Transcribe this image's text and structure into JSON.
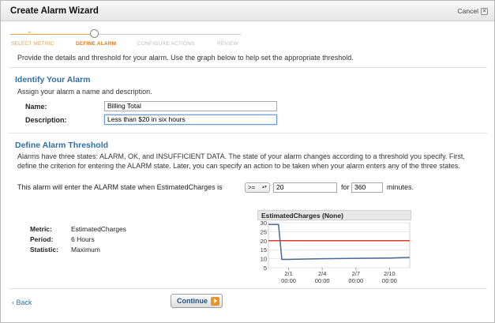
{
  "dialog": {
    "title": "Create Alarm Wizard",
    "cancel_label": "Cancel"
  },
  "wizard": {
    "steps": [
      {
        "label": "SELECT METRIC",
        "state": "done"
      },
      {
        "label": "DEFINE ALARM",
        "state": "active"
      },
      {
        "label": "CONFIGURE ACTIONS",
        "state": "pending"
      },
      {
        "label": "REVIEW",
        "state": "pending"
      }
    ]
  },
  "intro": "Provide the details and threshold for your alarm. Use the graph below to help set the appropriate threshold.",
  "identify": {
    "title": "Identify Your Alarm",
    "description": "Assign your alarm a name and description.",
    "name_label": "Name:",
    "name_value": "Billing Total",
    "description_label": "Description:",
    "description_value": "Less than $20 in six hours"
  },
  "threshold": {
    "title": "Define Alarm Threshold",
    "description": "Alarms have three states: ALARM, OK, and INSUFFICIENT DATA. The state of your alarm changes according to a threshold you specify. First, define the criterion for entering the ALARM state. Later, you can specify an action to be taken when your alarm enters any of the three states.",
    "sentence_prefix": "This alarm will enter the ALARM state when EstimatedCharges is",
    "operator": ">=",
    "threshold_value": "20",
    "for_label": "for",
    "period_value": "360",
    "minutes_label": "minutes."
  },
  "metric_info": {
    "metric_label": "Metric:",
    "metric_value": "EstimatedCharges",
    "period_label": "Period:",
    "period_value": "6 Hours",
    "statistic_label": "Statistic:",
    "statistic_value": "Maximum"
  },
  "chart_data": {
    "type": "line",
    "title": "EstimatedCharges (None)",
    "xlabel": "",
    "ylabel": "",
    "ylim": [
      5,
      30
    ],
    "yticks": [
      5,
      10,
      15,
      20,
      25,
      30
    ],
    "xticks": [
      {
        "line1": "2/1",
        "line2": "00:00",
        "day": 1
      },
      {
        "line1": "2/4",
        "line2": "00:00",
        "day": 4
      },
      {
        "line1": "2/7",
        "line2": "00:00",
        "day": 7
      },
      {
        "line1": "2/10",
        "line2": "00:00",
        "day": 10
      }
    ],
    "xlim": [
      -0.8,
      11.8
    ],
    "series": [
      {
        "color": "#4a6a8f",
        "points": [
          [
            -0.8,
            29
          ],
          [
            0,
            29
          ],
          [
            0.1,
            29
          ],
          [
            0.4,
            9.6
          ],
          [
            1,
            9.6
          ],
          [
            4,
            10
          ],
          [
            7,
            10.2
          ],
          [
            10,
            10.4
          ],
          [
            11.8,
            10.7
          ]
        ]
      }
    ],
    "threshold_line": {
      "value": 20,
      "color": "#e03a2f"
    },
    "grid": true
  },
  "footer": {
    "back_label": "Back",
    "back_glyph": "‹",
    "continue_label": "Continue"
  },
  "colors": {
    "accent": "#e8942a",
    "section_title": "#2f6fa3",
    "threshold": "#e03a2f"
  }
}
